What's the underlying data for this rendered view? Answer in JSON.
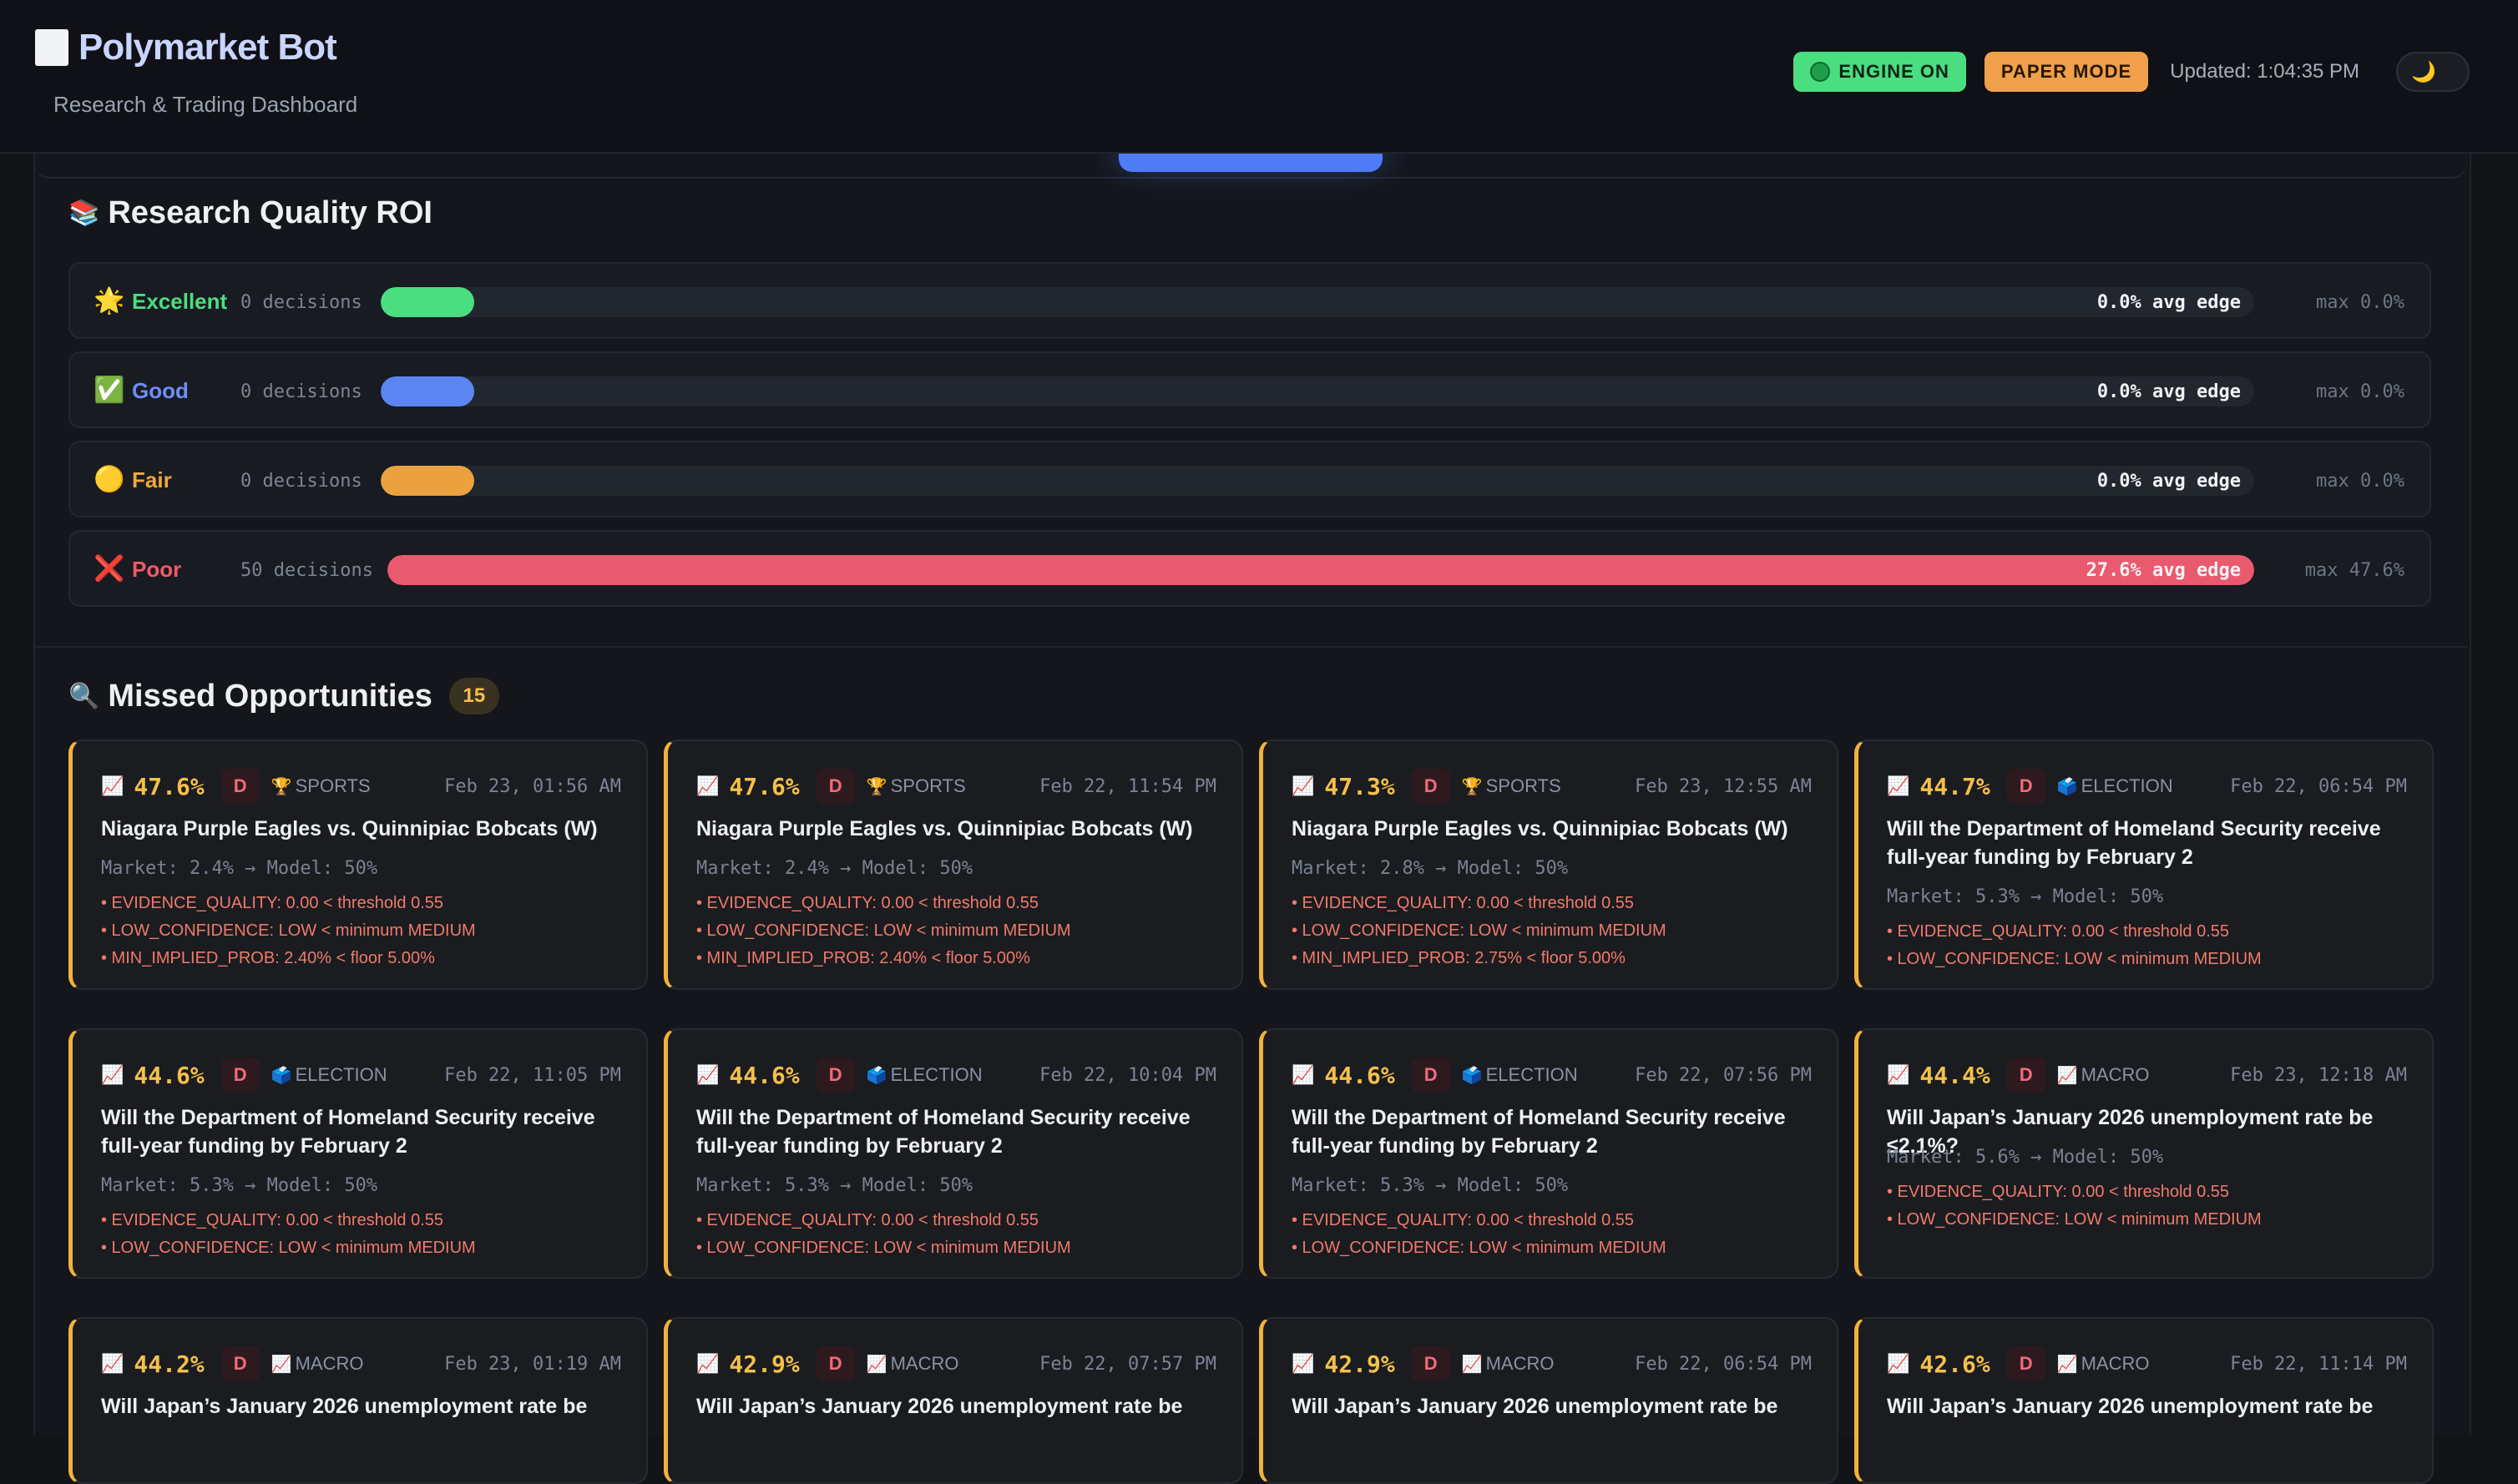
{
  "header": {
    "title": "Polymarket Bot",
    "subtitle": "Research & Trading Dashboard",
    "engine_label": "ENGINE ON",
    "mode_label": "PAPER MODE",
    "updated": "Updated: 1:04:35 PM",
    "theme_icon": "🌙"
  },
  "research_quality": {
    "emoji": "📚",
    "title": "Research Quality ROI",
    "rows": [
      {
        "icon": "🌟",
        "label": "Excellent",
        "decisions": "0 decisions",
        "edge": "",
        "max": "max 0.0%",
        "color": "#4ade80",
        "fill": 0.05,
        "label_color": "#4ade80",
        "edge_outside": "0.0% avg edge"
      },
      {
        "icon": "✅",
        "label": "Good",
        "decisions": "0 decisions",
        "edge": "",
        "max": "max 0.0%",
        "color": "#5b85f0",
        "fill": 0.05,
        "label_color": "#6b8ff5",
        "edge_outside": "0.0% avg edge"
      },
      {
        "icon": "🟡",
        "label": "Fair",
        "decisions": "0 decisions",
        "edge": "",
        "max": "max 0.0%",
        "color": "#eba13e",
        "fill": 0.05,
        "label_color": "#f0a83c",
        "edge_outside": "0.0% avg edge"
      },
      {
        "icon": "❌",
        "label": "Poor",
        "decisions": "50 decisions",
        "edge": "27.6% avg edge",
        "max": "max 47.6%",
        "color": "#ea5a6e",
        "fill": 1.0,
        "label_color": "#f0596a",
        "edge_outside": ""
      }
    ]
  },
  "missed": {
    "emoji": "🔍",
    "title": "Missed Opportunities",
    "count": "15",
    "cards": [
      {
        "pct": "47.6%",
        "grade": "D",
        "cat_icon": "🏆",
        "category": "SPORTS",
        "date": "Feb 23, 01:56 AM",
        "title": "Niagara Purple Eagles vs. Quinnipiac Bobcats (W)",
        "market": "Market: 2.4% → Model: 50%",
        "reasons": [
          "• EVIDENCE_QUALITY: 0.00 < threshold 0.55",
          "• LOW_CONFIDENCE: LOW < minimum MEDIUM",
          "• MIN_IMPLIED_PROB: 2.40% < floor 5.00%"
        ]
      },
      {
        "pct": "47.6%",
        "grade": "D",
        "cat_icon": "🏆",
        "category": "SPORTS",
        "date": "Feb 22, 11:54 PM",
        "title": "Niagara Purple Eagles vs. Quinnipiac Bobcats (W)",
        "market": "Market: 2.4% → Model: 50%",
        "reasons": [
          "• EVIDENCE_QUALITY: 0.00 < threshold 0.55",
          "• LOW_CONFIDENCE: LOW < minimum MEDIUM",
          "• MIN_IMPLIED_PROB: 2.40% < floor 5.00%"
        ]
      },
      {
        "pct": "47.3%",
        "grade": "D",
        "cat_icon": "🏆",
        "category": "SPORTS",
        "date": "Feb 23, 12:55 AM",
        "title": "Niagara Purple Eagles vs. Quinnipiac Bobcats (W)",
        "market": "Market: 2.8% → Model: 50%",
        "reasons": [
          "• EVIDENCE_QUALITY: 0.00 < threshold 0.55",
          "• LOW_CONFIDENCE: LOW < minimum MEDIUM",
          "• MIN_IMPLIED_PROB: 2.75% < floor 5.00%"
        ]
      },
      {
        "pct": "44.7%",
        "grade": "D",
        "cat_icon": "🗳️",
        "category": "ELECTION",
        "date": "Feb 22, 06:54 PM",
        "title": "Will the Department of Homeland Security receive full-year funding by February 2",
        "market": "Market: 5.3% → Model: 50%",
        "reasons": [
          "• EVIDENCE_QUALITY: 0.00 < threshold 0.55",
          "• LOW_CONFIDENCE: LOW < minimum MEDIUM"
        ]
      },
      {
        "pct": "44.6%",
        "grade": "D",
        "cat_icon": "🗳️",
        "category": "ELECTION",
        "date": "Feb 22, 11:05 PM",
        "title": "Will the Department of Homeland Security receive full-year funding by February 2",
        "market": "Market: 5.3% → Model: 50%",
        "reasons": [
          "• EVIDENCE_QUALITY: 0.00 < threshold 0.55",
          "• LOW_CONFIDENCE: LOW < minimum MEDIUM"
        ]
      },
      {
        "pct": "44.6%",
        "grade": "D",
        "cat_icon": "🗳️",
        "category": "ELECTION",
        "date": "Feb 22, 10:04 PM",
        "title": "Will the Department of Homeland Security receive full-year funding by February 2",
        "market": "Market: 5.3% → Model: 50%",
        "reasons": [
          "• EVIDENCE_QUALITY: 0.00 < threshold 0.55",
          "• LOW_CONFIDENCE: LOW < minimum MEDIUM"
        ]
      },
      {
        "pct": "44.6%",
        "grade": "D",
        "cat_icon": "🗳️",
        "category": "ELECTION",
        "date": "Feb 22, 07:56 PM",
        "title": "Will the Department of Homeland Security receive full-year funding by February 2",
        "market": "Market: 5.3% → Model: 50%",
        "reasons": [
          "• EVIDENCE_QUALITY: 0.00 < threshold 0.55",
          "• LOW_CONFIDENCE: LOW < minimum MEDIUM"
        ]
      },
      {
        "pct": "44.4%",
        "grade": "D",
        "cat_icon": "📈",
        "category": "MACRO",
        "date": "Feb 23, 12:18 AM",
        "title": "Will Japan’s January 2026 unemployment rate be ≤2.1%?",
        "market": "Market: 5.6% → Model: 50%",
        "reasons": [
          "• EVIDENCE_QUALITY: 0.00 < threshold 0.55",
          "• LOW_CONFIDENCE: LOW < minimum MEDIUM"
        ]
      },
      {
        "pct": "44.2%",
        "grade": "D",
        "cat_icon": "📈",
        "category": "MACRO",
        "date": "Feb 23, 01:19 AM",
        "title": "Will Japan’s January 2026 unemployment rate be",
        "market": "",
        "reasons": []
      },
      {
        "pct": "42.9%",
        "grade": "D",
        "cat_icon": "📈",
        "category": "MACRO",
        "date": "Feb 22, 07:57 PM",
        "title": "Will Japan’s January 2026 unemployment rate be",
        "market": "",
        "reasons": []
      },
      {
        "pct": "42.9%",
        "grade": "D",
        "cat_icon": "📈",
        "category": "MACRO",
        "date": "Feb 22, 06:54 PM",
        "title": "Will Japan’s January 2026 unemployment rate be",
        "market": "",
        "reasons": []
      },
      {
        "pct": "42.6%",
        "grade": "D",
        "cat_icon": "📈",
        "category": "MACRO",
        "date": "Feb 22, 11:14 PM",
        "title": "Will Japan’s January 2026 unemployment rate be",
        "market": "",
        "reasons": []
      }
    ]
  }
}
